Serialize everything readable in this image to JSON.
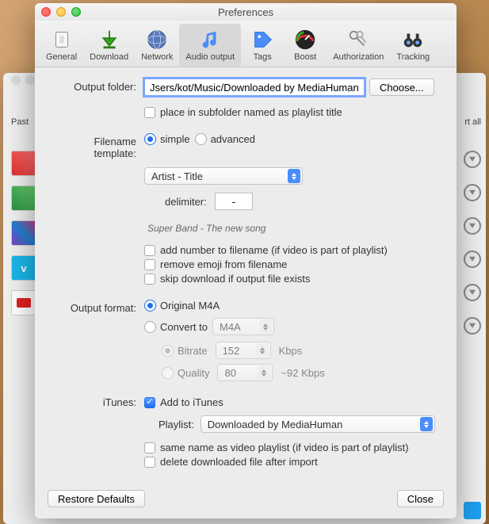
{
  "window": {
    "title": "Preferences"
  },
  "tabs": {
    "general": "General",
    "download": "Download",
    "network": "Network",
    "audio": "Audio output",
    "tags": "Tags",
    "boost": "Boost",
    "authorization": "Authorization",
    "tracking": "Tracking",
    "active": "audio"
  },
  "output_folder": {
    "label": "Output folder:",
    "value": "Jsers/kot/Music/Downloaded by MediaHuman",
    "choose": "Choose...",
    "subfolder_check": "place in subfolder named as playlist title"
  },
  "filename": {
    "label": "Filename template:",
    "simple": "simple",
    "advanced": "advanced",
    "mode": "simple",
    "template_select": "Artist - Title",
    "delimiter_label": "delimiter:",
    "delimiter_value": "-",
    "sample": "Super Band - The new song",
    "add_number": "add number to filename (if video is part of playlist)",
    "remove_emoji": "remove emoji from filename",
    "skip": "skip download if output file exists"
  },
  "format": {
    "label": "Output format:",
    "original": "Original M4A",
    "convert": "Convert to",
    "convert_select": "M4A",
    "bitrate_label": "Bitrate",
    "bitrate_value": "152",
    "bitrate_unit": "Kbps",
    "quality_label": "Quality",
    "quality_value": "80",
    "quality_hint": "~92 Kbps",
    "selected": "original"
  },
  "itunes": {
    "label": "iTunes:",
    "add": "Add to iTunes",
    "add_checked": true,
    "playlist_label": "Playlist:",
    "playlist_value": "Downloaded by MediaHuman",
    "same_name": "same name as video playlist (if video is part of playlist)",
    "delete_after": "delete downloaded file after import"
  },
  "footer": {
    "restore": "Restore Defaults",
    "close": "Close"
  },
  "bg": {
    "paste": "Past",
    "rtall": "rt all"
  }
}
